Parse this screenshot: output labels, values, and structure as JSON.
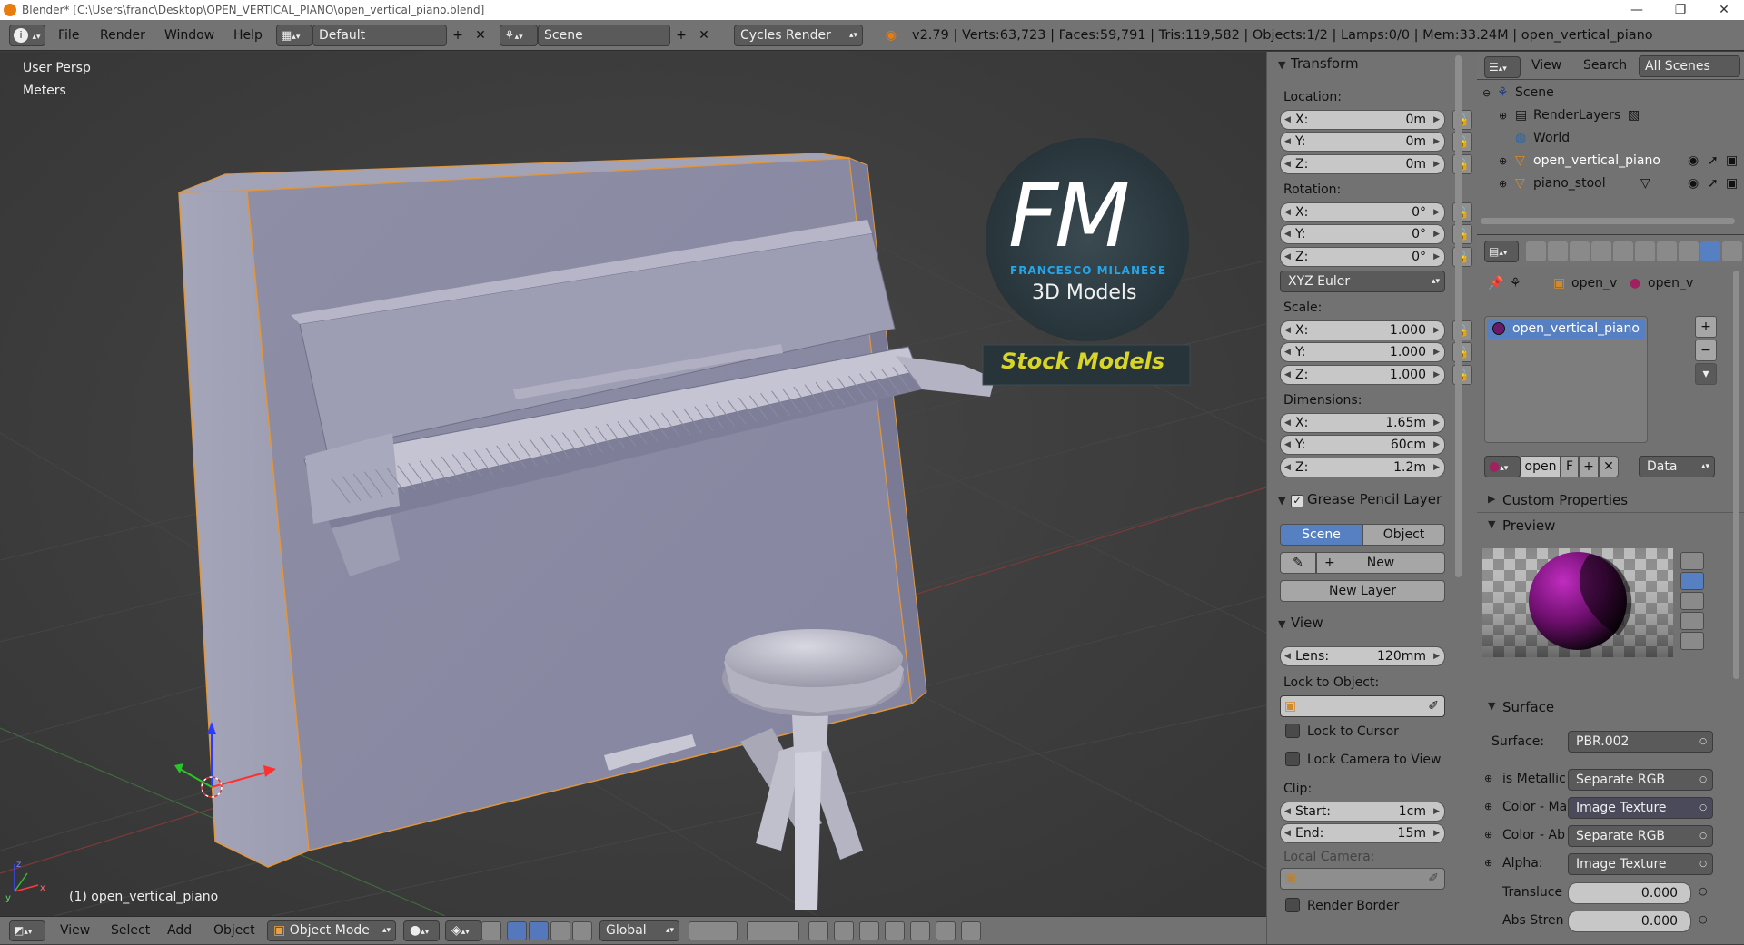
{
  "titlebar": {
    "title": "Blender* [C:\\Users\\franc\\Desktop\\OPEN_VERTICAL_PIANO\\open_vertical_piano.blend]",
    "minimize": "—",
    "maximize": "❐",
    "close": "✕"
  },
  "header": {
    "menus": [
      "File",
      "Render",
      "Window",
      "Help"
    ],
    "layout": "Default",
    "scene": "Scene",
    "engine": "Cycles Render",
    "stats": "v2.79 | Verts:63,723 | Faces:59,791 | Tris:119,582 | Objects:1/2 | Lamps:0/0 | Mem:33.24M | open_vertical_piano"
  },
  "viewport": {
    "view_name": "User Persp",
    "units": "Meters",
    "object_label": "(1) open_vertical_piano",
    "logo": {
      "letters": "FM",
      "name": "FRANCESCO MILANESE",
      "sub": "3D Models",
      "banner": "Stock Models"
    }
  },
  "footer": {
    "menus": [
      "View",
      "Select",
      "Add",
      "Object"
    ],
    "mode": "Object Mode",
    "orientation": "Global"
  },
  "npanel": {
    "transform_title": "Transform",
    "location_label": "Location:",
    "location": [
      {
        "k": "X:",
        "v": "0m"
      },
      {
        "k": "Y:",
        "v": "0m"
      },
      {
        "k": "Z:",
        "v": "0m"
      }
    ],
    "rotation_label": "Rotation:",
    "rotation": [
      {
        "k": "X:",
        "v": "0°"
      },
      {
        "k": "Y:",
        "v": "0°"
      },
      {
        "k": "Z:",
        "v": "0°"
      }
    ],
    "rotation_mode": "XYZ Euler",
    "scale_label": "Scale:",
    "scale": [
      {
        "k": "X:",
        "v": "1.000"
      },
      {
        "k": "Y:",
        "v": "1.000"
      },
      {
        "k": "Z:",
        "v": "1.000"
      }
    ],
    "dimensions_label": "Dimensions:",
    "dimensions": [
      {
        "k": "X:",
        "v": "1.65m"
      },
      {
        "k": "Y:",
        "v": "60cm"
      },
      {
        "k": "Z:",
        "v": "1.2m"
      }
    ],
    "grease_title": "Grease Pencil Layer",
    "gp_scene": "Scene",
    "gp_object": "Object",
    "gp_new": "New",
    "gp_new_layer": "New Layer",
    "view_title": "View",
    "lens_label": "Lens:",
    "lens_value": "120mm",
    "lock_to_object": "Lock to Object:",
    "lock_to_cursor": "Lock to Cursor",
    "lock_camera": "Lock Camera to View",
    "clip_label": "Clip:",
    "clip_start_k": "Start:",
    "clip_start_v": "1cm",
    "clip_end_k": "End:",
    "clip_end_v": "15m",
    "local_camera": "Local Camera:",
    "render_border": "Render Border"
  },
  "outliner": {
    "view": "View",
    "search": "Search",
    "filter": "All Scenes",
    "items": [
      "Scene",
      "RenderLayers",
      "World",
      "open_vertical_piano",
      "piano_stool"
    ]
  },
  "properties": {
    "breadcrumb_obj": "open_v",
    "breadcrumb_mat": "open_v",
    "material_slot": "open_vertical_piano",
    "mat_name": "open",
    "mat_f": "F",
    "link": "Data",
    "custom_props": "Custom Properties",
    "preview": "Preview",
    "surface_title": "Surface",
    "surface_label": "Surface:",
    "surface_value": "PBR.002",
    "inputs": [
      {
        "label": "is Metallic",
        "value": "Separate RGB"
      },
      {
        "label": "Color - Ma",
        "value": "Image Texture"
      },
      {
        "label": "Color - Ab",
        "value": "Separate RGB"
      },
      {
        "label": "Alpha:",
        "value": "Image Texture"
      }
    ],
    "translucency_label": "Transluce",
    "translucency_value": "0.000",
    "abs_label": "Abs Stren",
    "abs_value": "0.000"
  }
}
